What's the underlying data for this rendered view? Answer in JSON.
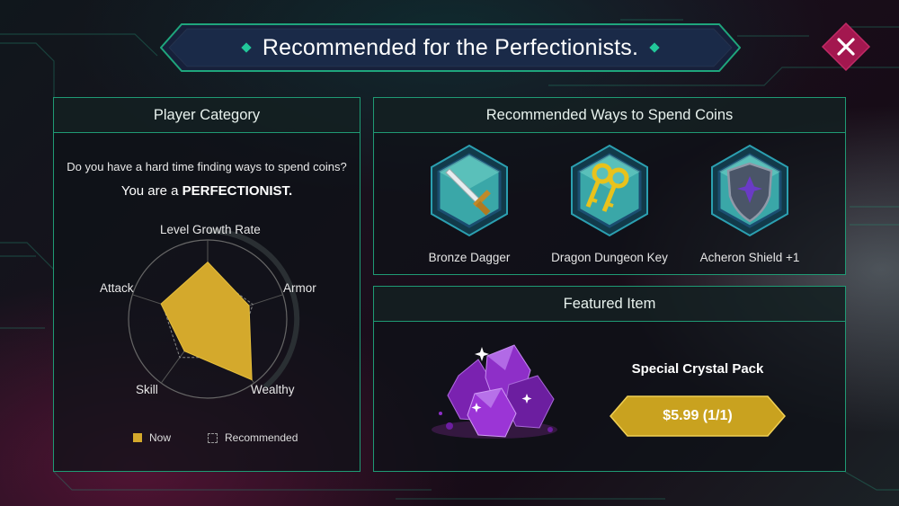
{
  "banner": {
    "title": "Recommended for the Perfectionists."
  },
  "close": {
    "icon": "close-icon"
  },
  "player_category": {
    "header": "Player Category",
    "question": "Do you have a hard time finding ways to spend coins?",
    "result_prefix": "You are a ",
    "result_type": "PERFECTIONIST.",
    "radar": {
      "axes": [
        "Level Growth Rate",
        "Armor",
        "Wealthy",
        "Skill",
        "Attack"
      ],
      "now": [
        0.72,
        0.55,
        0.95,
        0.5,
        0.62
      ],
      "recommended": [
        0.6,
        0.6,
        0.6,
        0.6,
        0.6
      ]
    },
    "legend": {
      "now": "Now",
      "recommended": "Recommended"
    }
  },
  "spend": {
    "header": "Recommended Ways to Spend Coins",
    "items": [
      {
        "label": "Bronze Dagger",
        "icon": "dagger-icon"
      },
      {
        "label": "Dragon Dungeon Key",
        "icon": "key-icon"
      },
      {
        "label": "Acheron Shield +1",
        "icon": "shield-icon"
      }
    ]
  },
  "featured": {
    "header": "Featured Item",
    "name": "Special Crystal Pack",
    "price": "$5.99 (1/1)",
    "icon": "crystal-icon"
  },
  "colors": {
    "accent": "#1f9a74",
    "gold": "#d4a92c",
    "close": "#a3174f"
  }
}
